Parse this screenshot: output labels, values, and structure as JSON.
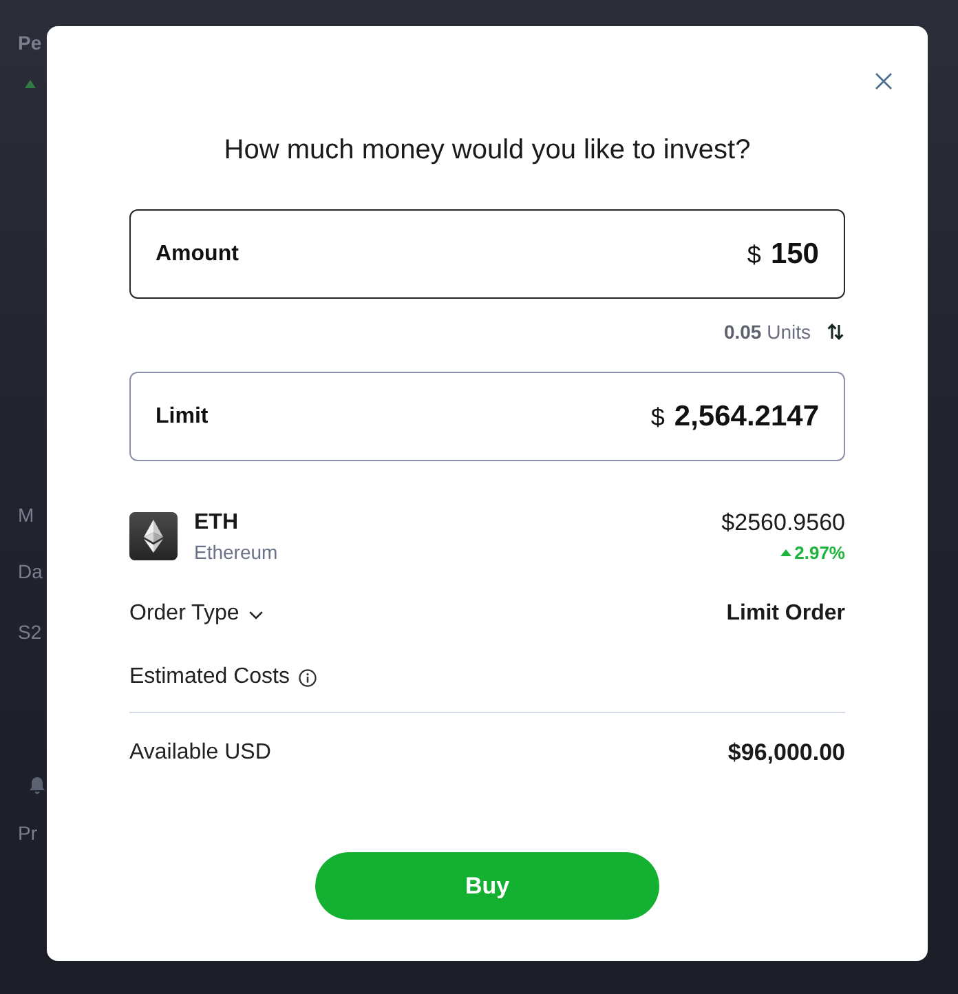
{
  "background": {
    "texts": [
      "Pe",
      "M",
      "Da",
      "S2",
      "Pr"
    ]
  },
  "dialog": {
    "title": "How much money would you like to invest?",
    "amount_field": {
      "label": "Amount",
      "currency": "$",
      "value": "150"
    },
    "units": {
      "value": "0.05",
      "unit": "Units"
    },
    "limit_field": {
      "label": "Limit",
      "currency": "$",
      "value": "2,564.2147"
    },
    "asset": {
      "symbol": "ETH",
      "name": "Ethereum",
      "price": "$2560.9560",
      "change": "2.97%",
      "rising": true
    },
    "order_type": {
      "label": "Order Type",
      "value": "Limit Order"
    },
    "estimated_costs": {
      "label": "Estimated Costs"
    },
    "available": {
      "label": "Available USD",
      "value": "$96,000.00"
    },
    "buy_button": {
      "label": "Buy"
    }
  }
}
